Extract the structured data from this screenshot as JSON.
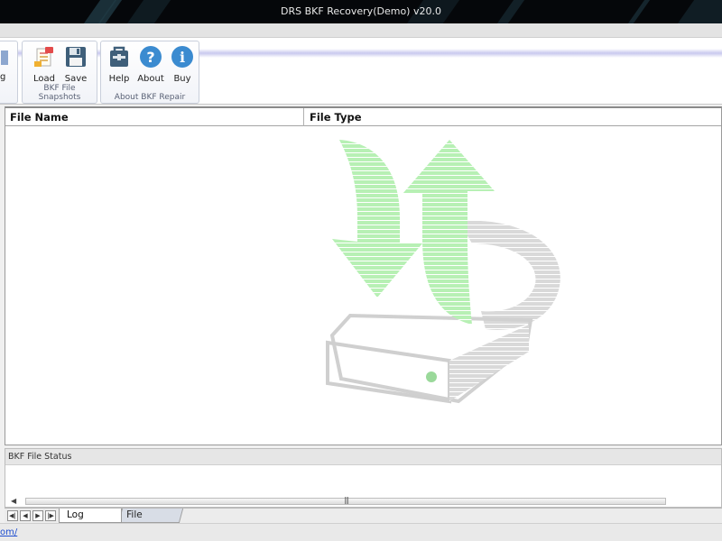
{
  "window": {
    "title": "DRS BKF Recovery(Demo) v20.0"
  },
  "ribbon": {
    "partial_group": {
      "button_label_fragment": "g"
    },
    "snapshots_group": {
      "label": "BKF File Snapshots",
      "buttons": [
        {
          "label": "Load",
          "icon": "load-icon"
        },
        {
          "label": "Save",
          "icon": "save-icon"
        }
      ]
    },
    "about_group": {
      "label": "About BKF Repair",
      "buttons": [
        {
          "label": "Help",
          "icon": "help-icon"
        },
        {
          "label": "About",
          "icon": "about-icon"
        },
        {
          "label": "Buy",
          "icon": "buy-icon"
        }
      ]
    }
  },
  "file_list": {
    "columns": [
      "File Name",
      "File Type"
    ],
    "watermark_icon": "recovery-arrows-drive-icon",
    "rows": []
  },
  "status_panel": {
    "title": "BKF File Status"
  },
  "tabs": [
    "Log Window",
    "File Viewer"
  ],
  "bottom": {
    "url_fragment": "om/"
  },
  "colors": {
    "ribbon_accent": "#c9c9ee",
    "link": "#1f4fd0",
    "watermark_green": "#b7f0b4"
  }
}
